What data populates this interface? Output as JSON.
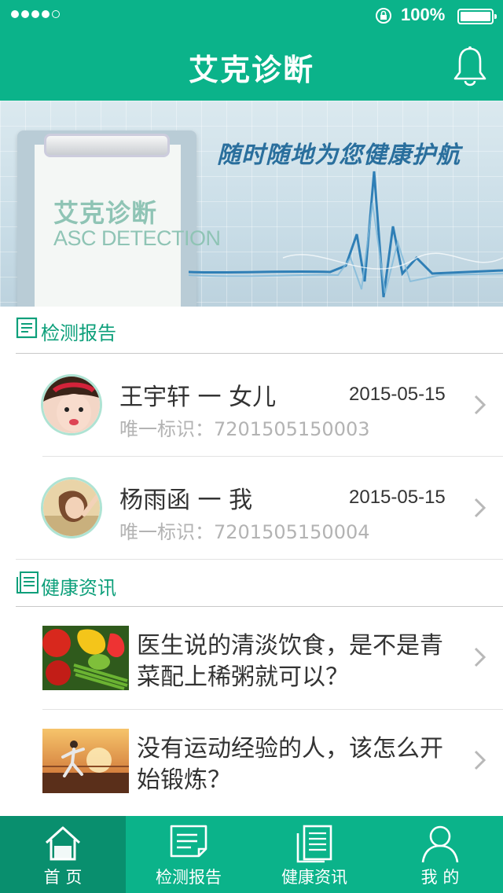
{
  "status_bar": {
    "battery_percent": "100%",
    "signal_bars": 4
  },
  "header": {
    "title": "艾克诊断",
    "bell_icon": "bell-icon"
  },
  "banner": {
    "board_title_cn": "艾克诊断",
    "board_title_en": "ASC DETECTION",
    "slogan": "随时随地为您健康护航"
  },
  "reports_section": {
    "title": "检测报告",
    "items": [
      {
        "name": "王宇轩 一 女儿",
        "date": "2015-05-15",
        "id_text": "唯一标识：7201505150003"
      },
      {
        "name": "杨雨函 一 我",
        "date": "2015-05-15",
        "id_text": "唯一标识：7201505150004"
      }
    ]
  },
  "news_section": {
    "title": "健康资讯",
    "items": [
      {
        "title": "医生说的清淡饮食，是不是青菜配上稀粥就可以？"
      },
      {
        "title": "没有运动经验的人，该怎么开始锻炼？"
      }
    ]
  },
  "tabbar": {
    "tabs": [
      {
        "label": "首 页",
        "icon": "home-icon",
        "active": true
      },
      {
        "label": "检测报告",
        "icon": "report-icon",
        "active": false
      },
      {
        "label": "健康资讯",
        "icon": "news-icon",
        "active": false
      },
      {
        "label": "我 的",
        "icon": "user-icon",
        "active": false
      }
    ]
  },
  "colors": {
    "brand": "#0bb38a",
    "brand_dark": "#098f6e",
    "section_title": "#0c9f7a"
  }
}
